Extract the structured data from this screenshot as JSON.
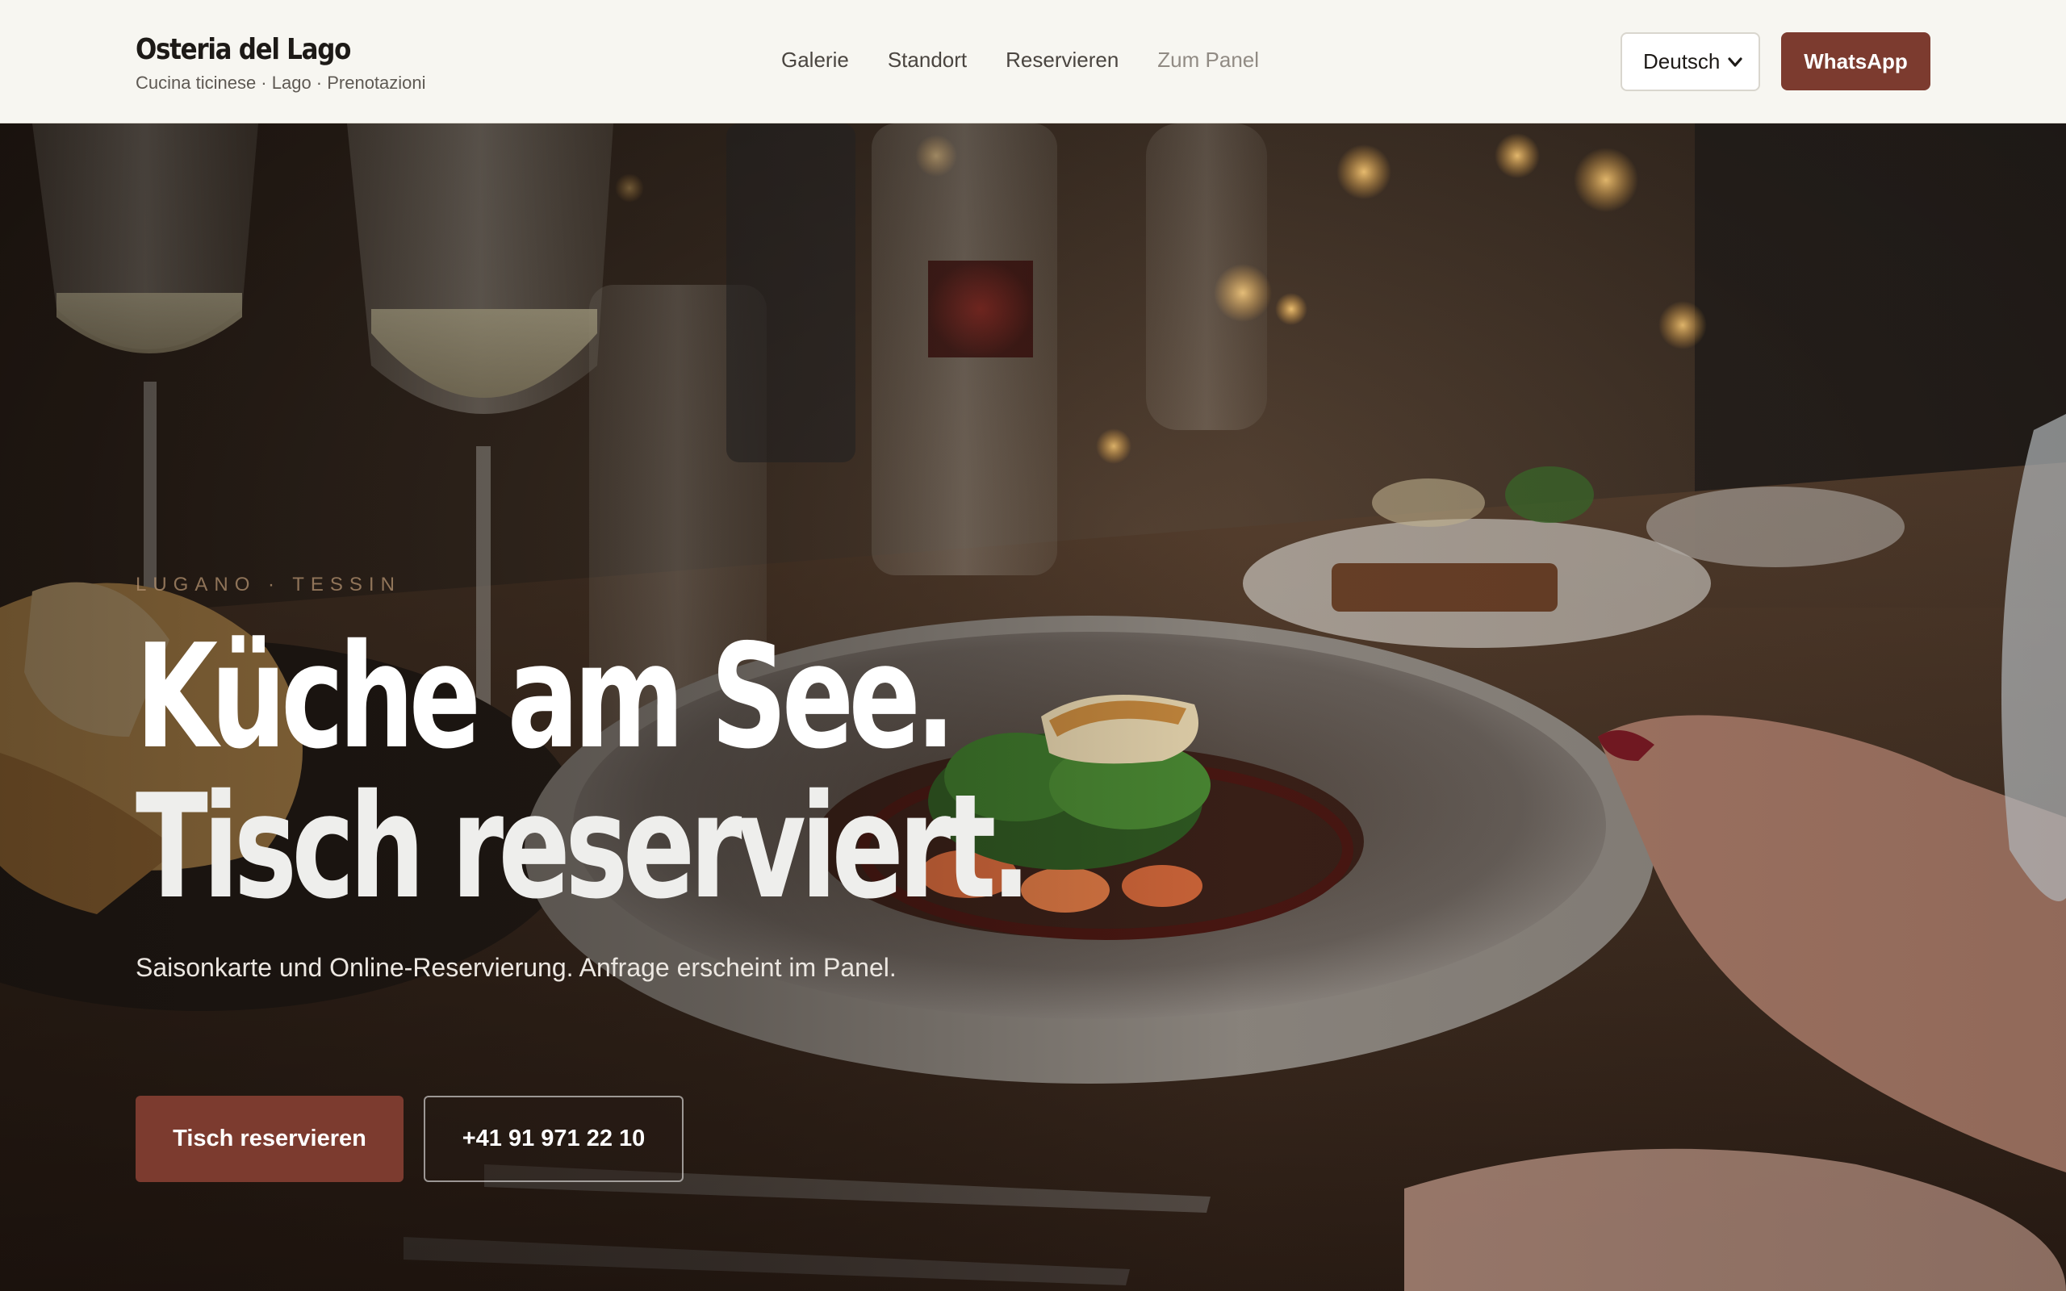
{
  "header": {
    "brand_name": "Osteria del Lago",
    "brand_tagline": "Cucina ticinese · Lago · Prenotazioni",
    "nav": [
      {
        "label": "Galerie"
      },
      {
        "label": "Standort"
      },
      {
        "label": "Reservieren"
      },
      {
        "label": "Zum Panel"
      }
    ],
    "language": {
      "selected": "Deutsch"
    },
    "whatsapp_label": "WhatsApp"
  },
  "hero": {
    "eyebrow": "LUGANO · TESSIN",
    "headline_line1": "Küche am See.",
    "headline_line2": "Tisch reserviert.",
    "subtext": "Saisonkarte und Online-Reservierung. Anfrage erscheint im Panel.",
    "cta_primary": "Tisch reservieren",
    "cta_phone": "+41 91 971 22 10",
    "image_alt": "restaurant-table-with-plated-dish-and-wine-glasses"
  },
  "colors": {
    "accent": "#7c3b2f",
    "header_bg": "#f7f6f1",
    "eyebrow": "#b49270"
  }
}
